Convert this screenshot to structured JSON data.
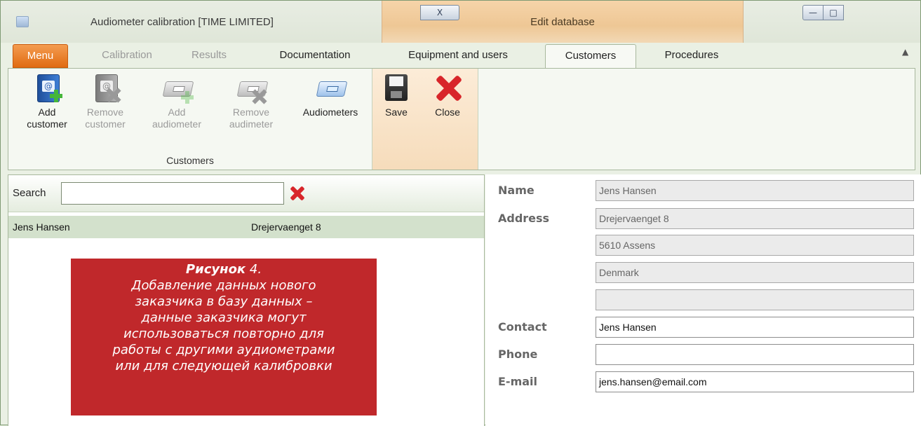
{
  "window": {
    "title": "Audiometer calibration [TIME LIMITED]",
    "context_title": "Edit database",
    "controls": {
      "minimize": "—",
      "maximize": "□",
      "close": "X"
    },
    "collapse_icon": "chevron-up-icon"
  },
  "tabs": {
    "menu": "Menu",
    "calibration": "Calibration",
    "results": "Results",
    "documentation": "Documentation",
    "equipment": "Equipment and users",
    "customers": "Customers",
    "procedures": "Procedures",
    "active": "Customers"
  },
  "ribbon": {
    "customers_group": {
      "label": "Customers",
      "add_customer": {
        "line1": "Add",
        "line2": "customer",
        "enabled": true
      },
      "remove_customer": {
        "line1": "Remove",
        "line2": "customer",
        "enabled": false
      },
      "add_audiometer": {
        "line1": "Add",
        "line2": "audiometer",
        "enabled": false
      },
      "remove_audimeter": {
        "line1": "Remove",
        "line2": "audimeter",
        "enabled": false
      },
      "audiometers": {
        "line1": "Audiometers",
        "enabled": true
      }
    },
    "edit_group": {
      "save": "Save",
      "close": "Close"
    }
  },
  "search": {
    "label": "Search",
    "value": ""
  },
  "customer_list": [
    {
      "name": "Jens Hansen",
      "address": "Drejervaenget 8"
    }
  ],
  "caption": {
    "head_bold": "Рисунок",
    "head_rest": " 4.",
    "lines": [
      "Добавление данных нового",
      "заказчика в базу данных –",
      "данные заказчика могут",
      "использоваться повторно для",
      "работы с другими аудиометрами",
      "или для следующей калибровки"
    ]
  },
  "details": {
    "name_label": "Name",
    "name": "Jens Hansen",
    "address_label": "Address",
    "address1": "Drejervaenget 8",
    "address2": "5610 Assens",
    "address3": "Denmark",
    "address4": "",
    "contact_label": "Contact",
    "contact": "Jens Hansen",
    "phone_label": "Phone",
    "phone": "",
    "email_label": "E-mail",
    "email": "jens.hansen@email.com"
  },
  "colors": {
    "menu_tab": "#e06b12",
    "context_band": "#eec795",
    "caption_bg": "#c0282b",
    "selected_row": "#d3e1cc",
    "delete_red": "#d8252a"
  }
}
